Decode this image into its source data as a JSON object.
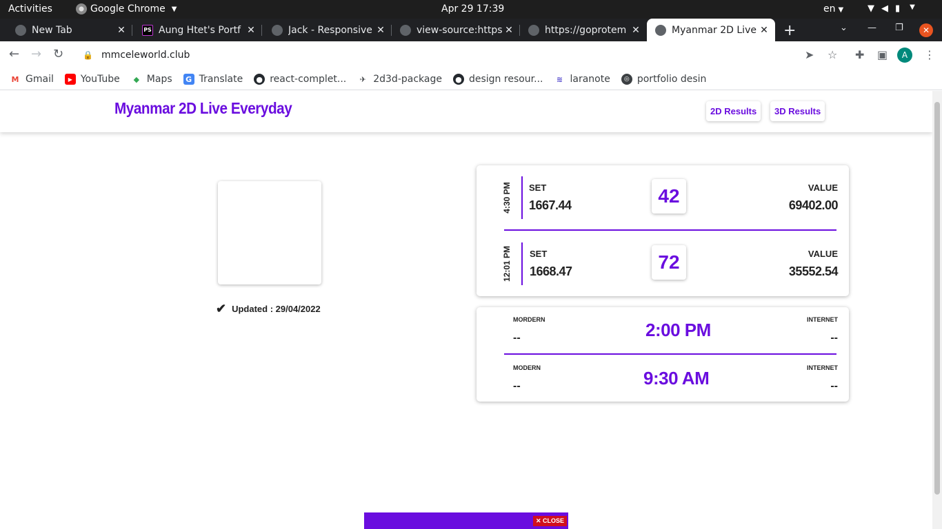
{
  "system": {
    "activities": "Activities",
    "app_name": "Google Chrome",
    "clock": "Apr 29  17:39",
    "language": "en"
  },
  "tabs": [
    {
      "title": "New Tab",
      "icon": "globe-icon"
    },
    {
      "title": "Aung Htet's Portf",
      "icon": "phpstorm-icon"
    },
    {
      "title": "Jack - Responsive",
      "icon": "globe-icon"
    },
    {
      "title": "view-source:https",
      "icon": "globe-icon"
    },
    {
      "title": "https://goprotem",
      "icon": "globe-icon"
    },
    {
      "title": "Myanmar 2D Live",
      "icon": "globe-icon"
    }
  ],
  "toolbar": {
    "url": "mmceleworld.club",
    "avatar_letter": "A"
  },
  "bookmarks": [
    {
      "label": "Gmail",
      "icon": "gmail-icon"
    },
    {
      "label": "YouTube",
      "icon": "youtube-icon"
    },
    {
      "label": "Maps",
      "icon": "maps-icon"
    },
    {
      "label": "Translate",
      "icon": "translate-icon"
    },
    {
      "label": "react-complet...",
      "icon": "github-icon"
    },
    {
      "label": "2d3d-package",
      "icon": "plane-icon"
    },
    {
      "label": "design resour...",
      "icon": "github-icon"
    },
    {
      "label": "laranote",
      "icon": "laravel-icon"
    },
    {
      "label": "portfolio desin",
      "icon": "globe-icon"
    }
  ],
  "site": {
    "brand": "Myanmar 2D Live Everyday",
    "nav": {
      "results_2d": "2D Results",
      "results_3d": "3D Results"
    },
    "updated": "Updated : 29/04/2022",
    "accent_color": "#6a0ddf"
  },
  "draws": [
    {
      "time": "4:30 PM",
      "set_label": "SET",
      "set": "1667.44",
      "result": "42",
      "value_label": "VALUE",
      "value": "69402.00"
    },
    {
      "time": "12:01 PM",
      "set_label": "SET",
      "set": "1668.47",
      "result": "72",
      "value_label": "VALUE",
      "value": "35552.54"
    }
  ],
  "schedule": [
    {
      "left_label": "MORDERN",
      "left_value": "--",
      "time": "2:00 PM",
      "right_label": "INTERNET",
      "right_value": "--"
    },
    {
      "left_label": "MODERN",
      "left_value": "--",
      "time": "9:30 AM",
      "right_label": "INTERNET",
      "right_value": "--"
    }
  ],
  "ad": {
    "close_label": "CLOSE"
  }
}
